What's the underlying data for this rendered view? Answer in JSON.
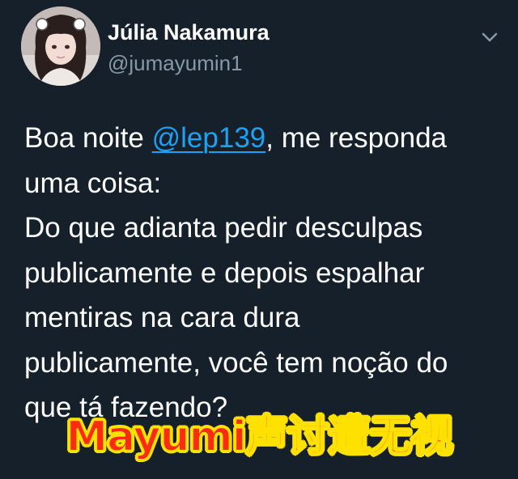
{
  "user": {
    "display_name": "Júlia Nakamura",
    "handle": "@jumayumin1",
    "avatar": "profile-photo"
  },
  "menu": {
    "icon": "chevron-down-icon"
  },
  "tweet": {
    "text_before": "Boa noite ",
    "mention": "@lep139",
    "text_after": ", me responda\numa coisa:\nDo que adianta pedir desculpas\npublicamente e depois espalhar\nmentiras na cara dura\npublicamente, você tem noção do\nque tá fazendo?"
  },
  "overlay_caption": "Mayumi声讨遭无视",
  "colors": {
    "background": "#15202b",
    "name": "#ffffff",
    "handle": "#8899a6",
    "mention": "#1da1f2",
    "caption_fill": "#ff2a12",
    "caption_stroke": "#ffe100"
  }
}
